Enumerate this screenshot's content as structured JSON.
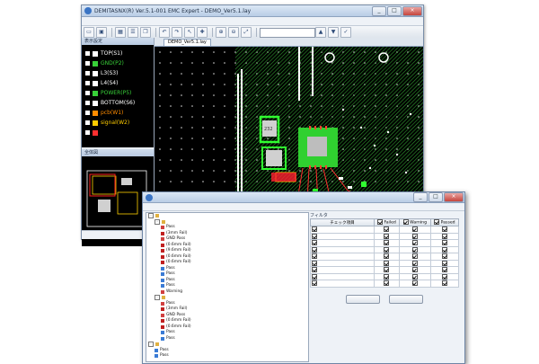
{
  "main_window": {
    "title": "DEMITASNX(R) Ver.5.1-001 EMC Expert - DEMO_Ver5.1.lay",
    "menu": [
      "",
      "",
      "",
      "",
      "",
      "",
      "",
      "",
      "",
      ""
    ],
    "toolbar": {
      "combo_value": ""
    },
    "canvas_tab": "DEMO_Ver5.1.lay",
    "layer_panel_title": "表示設定",
    "navigator_title": "全体図",
    "status_text": "",
    "layers": [
      {
        "label": "TOP(S1)",
        "color": "#ffffff"
      },
      {
        "label": "GND(P2)",
        "color": "#38d038"
      },
      {
        "label": "L3(S3)",
        "color": "#ffffff"
      },
      {
        "label": "L4(S4)",
        "color": "#ffffff"
      },
      {
        "label": "POWER(P5)",
        "color": "#38d038"
      },
      {
        "label": "BOTTOM(S6)",
        "color": "#ffffff"
      },
      {
        "label": "pcb(W1)",
        "color": "#ff8c00"
      },
      {
        "label": "signal(W2)",
        "color": "#ffcc00"
      },
      {
        "label": "",
        "color": "#ff3030"
      }
    ]
  },
  "dialog": {
    "title": "",
    "menu": [
      "",
      ""
    ],
    "tree": [
      {
        "level": 0,
        "expander": "-",
        "label": "",
        "icon": "folder"
      },
      {
        "level": 1,
        "expander": "-",
        "label": "",
        "icon": "folder"
      },
      {
        "level": 2,
        "expander": "",
        "label": "Pass",
        "icon": "warn"
      },
      {
        "level": 2,
        "expander": "",
        "label": "(3mm Fail)",
        "icon": "fail"
      },
      {
        "level": 2,
        "expander": "",
        "label": "GND Pass",
        "icon": "warn"
      },
      {
        "level": 2,
        "expander": "",
        "label": "(0.6mm Fail)",
        "icon": "fail"
      },
      {
        "level": 2,
        "expander": "",
        "label": "(9.6mm Fail)",
        "icon": "fail"
      },
      {
        "level": 2,
        "expander": "",
        "label": "(0.6mm Fail)",
        "icon": "fail"
      },
      {
        "level": 2,
        "expander": "",
        "label": "(0.6mm Fail)",
        "icon": "fail"
      },
      {
        "level": 2,
        "expander": "",
        "label": "Pass",
        "icon": "ok"
      },
      {
        "level": 2,
        "expander": "",
        "label": "Pass",
        "icon": "ok"
      },
      {
        "level": 2,
        "expander": "",
        "label": "Pass",
        "icon": "ok"
      },
      {
        "level": 2,
        "expander": "",
        "label": "Pass",
        "icon": "ok"
      },
      {
        "level": 2,
        "expander": "",
        "label": "Warning",
        "icon": "warn"
      },
      {
        "level": 1,
        "expander": "-",
        "label": "",
        "icon": "folder"
      },
      {
        "level": 2,
        "expander": "",
        "label": "Pass",
        "icon": "warn"
      },
      {
        "level": 2,
        "expander": "",
        "label": "(3mm Fail)",
        "icon": "fail"
      },
      {
        "level": 2,
        "expander": "",
        "label": "GND Pass",
        "icon": "warn"
      },
      {
        "level": 2,
        "expander": "",
        "label": "(0.6mm Fail)",
        "icon": "fail"
      },
      {
        "level": 2,
        "expander": "",
        "label": "(0.6mm Fail)",
        "icon": "fail"
      },
      {
        "level": 2,
        "expander": "",
        "label": "Pass",
        "icon": "ok"
      },
      {
        "level": 2,
        "expander": "",
        "label": "Pass",
        "icon": "ok"
      },
      {
        "level": 0,
        "expander": "-",
        "label": "",
        "icon": "folder"
      },
      {
        "level": 1,
        "expander": "",
        "label": "Pass",
        "icon": "ok"
      },
      {
        "level": 1,
        "expander": "",
        "label": "Pass",
        "icon": "ok"
      }
    ],
    "filter": {
      "label": "フィルタ",
      "columns": [
        "チェック項目",
        "Failed",
        "Warning",
        "Passed"
      ],
      "rows": [
        {
          "name": "",
          "failed": true,
          "warning": true,
          "passed": true
        },
        {
          "name": "",
          "failed": true,
          "warning": true,
          "passed": true
        },
        {
          "name": "",
          "failed": true,
          "warning": true,
          "passed": true
        },
        {
          "name": "",
          "failed": true,
          "warning": true,
          "passed": true
        },
        {
          "name": "",
          "failed": true,
          "warning": true,
          "passed": true
        },
        {
          "name": "",
          "failed": true,
          "warning": true,
          "passed": true
        },
        {
          "name": "",
          "failed": true,
          "warning": true,
          "passed": true
        },
        {
          "name": "",
          "failed": true,
          "warning": true,
          "passed": true
        },
        {
          "name": "",
          "failed": true,
          "warning": true,
          "passed": true
        }
      ],
      "buttons": {
        "select_all": "",
        "clear_all": ""
      }
    }
  }
}
